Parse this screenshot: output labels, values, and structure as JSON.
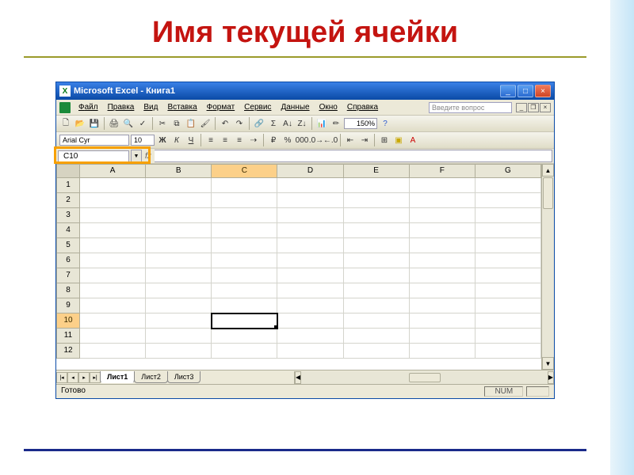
{
  "slide": {
    "title": "Имя текущей ячейки"
  },
  "window": {
    "app_icon_letter": "X",
    "title": "Microsoft Excel - Книга1",
    "help_placeholder": "Введите вопрос"
  },
  "menu": {
    "file": "Файл",
    "edit": "Правка",
    "view": "Вид",
    "insert": "Вставка",
    "format": "Формат",
    "tools": "Сервис",
    "data": "Данные",
    "window": "Окно",
    "help": "Справка"
  },
  "formatting": {
    "font": "Arial Cyr",
    "size": "10",
    "zoom": "150%"
  },
  "namebox": {
    "value": "C10",
    "fx": "fx"
  },
  "grid": {
    "columns": [
      "A",
      "B",
      "C",
      "D",
      "E",
      "F",
      "G"
    ],
    "row_count": 12,
    "active_col_index": 2,
    "active_row_index": 9
  },
  "sheets": {
    "s1": "Лист1",
    "s2": "Лист2",
    "s3": "Лист3"
  },
  "status": {
    "ready": "Готово",
    "num": "NUM"
  }
}
